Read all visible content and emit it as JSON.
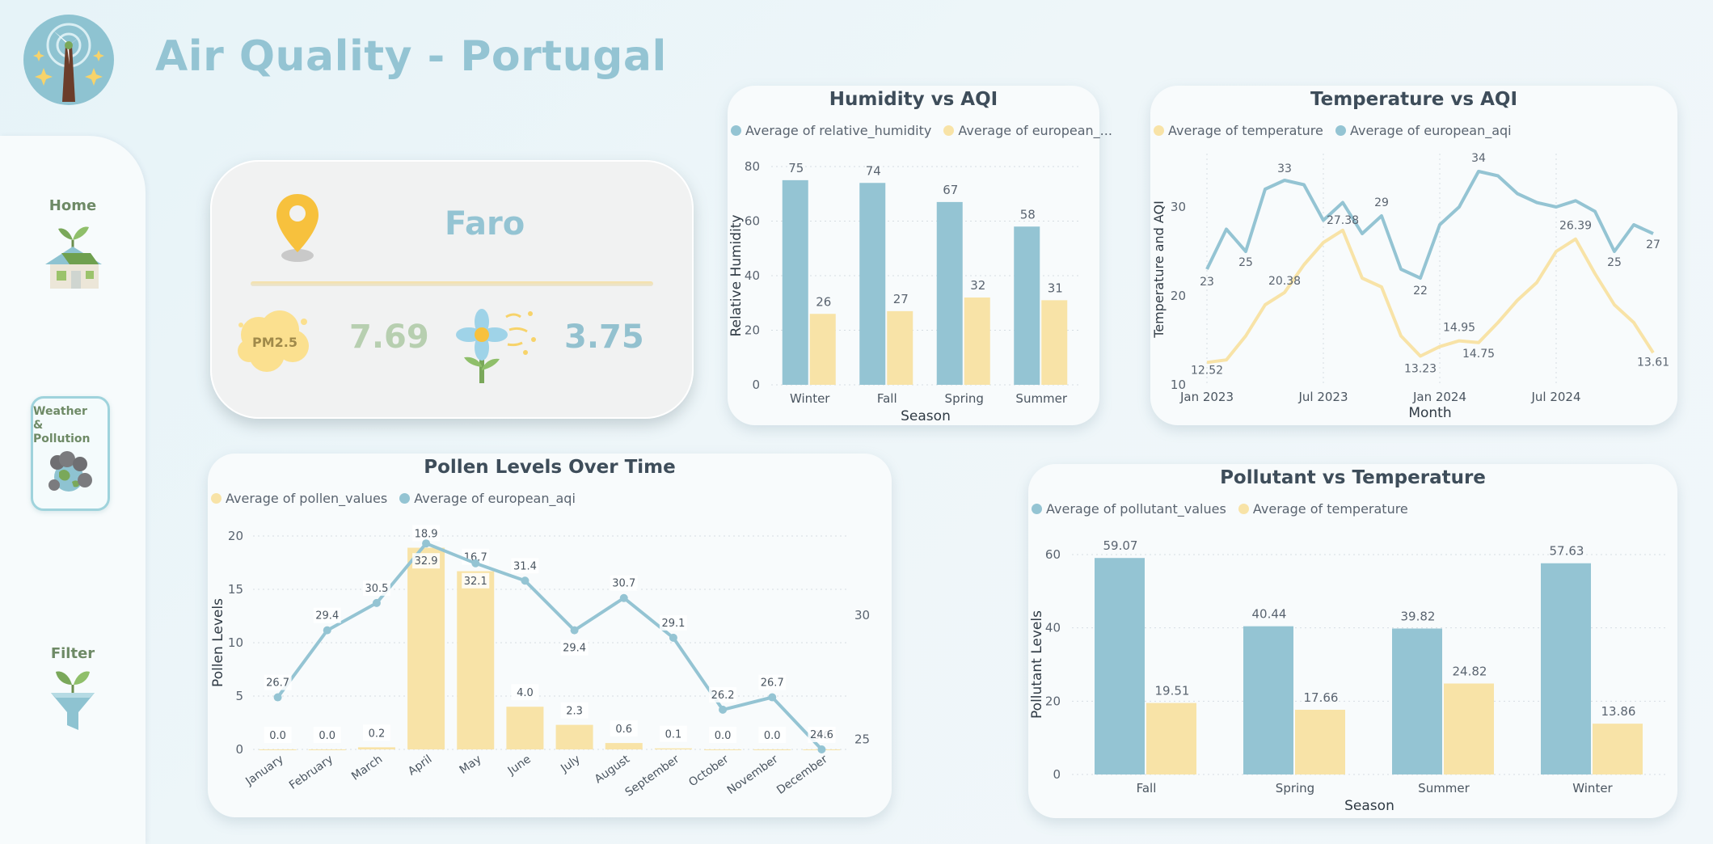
{
  "app": {
    "title": "Air Quality - Portugal"
  },
  "nav": {
    "home": "Home",
    "weather_line1": "Weather",
    "weather_line2": "&",
    "weather_line3": "Pollution",
    "filter": "Filter"
  },
  "location": {
    "city": "Faro",
    "pm25_label": "PM2.5",
    "pm25_value": "7.69",
    "pollen_value": "3.75"
  },
  "colors": {
    "blue": "#94c4d3",
    "yellow": "#f8e3a7",
    "title": "#94c4d3"
  },
  "chart_data": [
    {
      "id": "humidity",
      "type": "bar",
      "title": "Humidity vs AQI",
      "legend": [
        "Average of relative_humidity",
        "Average of european_..."
      ],
      "xlabel": "Season",
      "ylabel": "Relative Humidity",
      "categories": [
        "Winter",
        "Fall",
        "Spring",
        "Summer"
      ],
      "series": [
        {
          "name": "Average of relative_humidity",
          "values": [
            75,
            74,
            67,
            58
          ]
        },
        {
          "name": "Average of european_aqi",
          "values": [
            26,
            27,
            32,
            31
          ]
        }
      ],
      "yticks": [
        "0",
        "20",
        "40",
        "60",
        "80"
      ],
      "ylim": [
        0,
        80
      ]
    },
    {
      "id": "temperature",
      "type": "line",
      "title": "Temperature vs AQI",
      "legend": [
        "Average of temperature",
        "Average of european_aqi"
      ],
      "xlabel": "Month",
      "ylabel": "Temperature and AQI",
      "xticks": [
        "Jan 2023",
        "Jul 2023",
        "Jan 2024",
        "Jul 2024"
      ],
      "yticks": [
        "10",
        "20",
        "30"
      ],
      "ylim": [
        10,
        36
      ],
      "series": [
        {
          "name": "Average of temperature",
          "values": [
            12.52,
            12.8,
            15.5,
            19.0,
            20.38,
            23.5,
            26.0,
            27.38,
            22.0,
            21.0,
            15.5,
            13.23,
            14.3,
            14.95,
            14.75,
            17.0,
            19.5,
            21.5,
            25.0,
            26.39,
            22.5,
            19.0,
            17.0,
            13.61
          ]
        },
        {
          "name": "Average of european_aqi",
          "values": [
            23,
            27.5,
            25,
            32,
            33,
            32.5,
            28.5,
            30.5,
            27,
            29,
            23,
            22,
            28,
            30,
            34,
            33.5,
            31.5,
            30.5,
            30,
            30.7,
            29.5,
            25,
            28,
            27
          ]
        }
      ],
      "temp_labels": [
        "12.52",
        "20.38",
        "27.38",
        "13.23",
        "14.95",
        "14.75",
        "26.39",
        "13.61"
      ],
      "aqi_labels": [
        "23",
        "25",
        "33",
        "29",
        "22",
        "34",
        "25",
        "27"
      ]
    },
    {
      "id": "pollen",
      "type": "bar",
      "title": "Pollen Levels Over Time",
      "legend": [
        "Average of pollen_values",
        "Average of european_aqi"
      ],
      "ylabel": "Pollen Levels",
      "categories": [
        "January",
        "February",
        "March",
        "April",
        "May",
        "June",
        "July",
        "August",
        "September",
        "October",
        "November",
        "December"
      ],
      "series": [
        {
          "name": "Average of pollen_values",
          "values": [
            0.0,
            0.0,
            0.2,
            18.9,
            16.7,
            4.0,
            2.3,
            0.6,
            0.1,
            0.0,
            0.0,
            0.0
          ]
        },
        {
          "name": "Average of european_aqi",
          "values": [
            26.7,
            29.4,
            30.5,
            32.9,
            32.1,
            31.4,
            29.4,
            30.7,
            29.1,
            26.2,
            26.7,
            24.6
          ]
        }
      ],
      "yticks": [
        "0",
        "5",
        "10",
        "15",
        "20"
      ],
      "y2ticks": [
        "25",
        "30"
      ],
      "ylim": [
        0,
        20
      ],
      "y2lim": [
        24.6,
        33.2
      ]
    },
    {
      "id": "pollutant",
      "type": "bar",
      "title": "Pollutant vs Temperature",
      "legend": [
        "Average of pollutant_values",
        "Average of temperature"
      ],
      "xlabel": "Season",
      "ylabel": "Pollutant Levels",
      "categories": [
        "Fall",
        "Spring",
        "Summer",
        "Winter"
      ],
      "series": [
        {
          "name": "Average of pollutant_values",
          "values": [
            59.07,
            40.44,
            39.82,
            57.63
          ]
        },
        {
          "name": "Average of temperature",
          "values": [
            19.51,
            17.66,
            24.82,
            13.86
          ]
        }
      ],
      "yticks": [
        "0",
        "20",
        "40",
        "60"
      ],
      "ylim": [
        0,
        60
      ]
    }
  ]
}
